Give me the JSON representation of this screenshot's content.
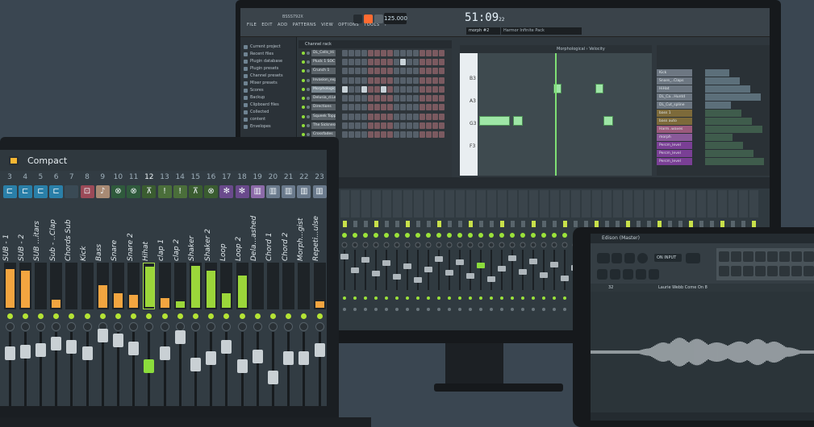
{
  "monitor": {
    "menu": [
      "FILE",
      "EDIT",
      "ADD",
      "PATTERNS",
      "VIEW",
      "OPTIONS",
      "TOOLS",
      "?"
    ],
    "project_id": "BSSS792X",
    "tempo": "125.000",
    "clock": {
      "main": "51:09",
      "sub": "22"
    },
    "pattern": "morph #2",
    "news": "Harmor Infinite Pack",
    "browser_items": [
      "Current project",
      "Recent files",
      "Plugin database",
      "Plugin presets",
      "Channel presets",
      "Mixer presets",
      "Scores",
      "Backup",
      "Clipboard files",
      "Collected",
      "content",
      "Envelopes"
    ],
    "rack_title": "Channel rack",
    "rack_channels": [
      "DL_Cells_Hi",
      "Pluck 1 SOC",
      "Crunch 1",
      "Invasion_expl",
      "Morphological",
      "Delusia_d.Lead",
      "Directions",
      "Squeek Topper",
      "The Sickness",
      "Crossfades"
    ],
    "pianoroll_header": "Morphological › Velocity",
    "key_labels": [
      "B3",
      "A3",
      "G3",
      "F3"
    ],
    "playlist_tracks": [
      "Kick",
      "Snare_..Claps",
      "HiHat",
      "DL_Ca...Huntd",
      "DL_Cut_spline",
      "bass 1",
      "bass auto",
      "Harm..waves",
      "morph",
      "Percm_level",
      "Percm_level",
      "Percm_level"
    ]
  },
  "laptop": {
    "title": "Compact",
    "channel_numbers": [
      "3",
      "4",
      "5",
      "6",
      "7",
      "8",
      "9",
      "10",
      "11",
      "12",
      "13",
      "14",
      "15",
      "16",
      "17",
      "18",
      "19",
      "20",
      "21",
      "22",
      "23"
    ],
    "channel_names": [
      "SUB - 1",
      "SUB - 2",
      "SUB ...itars",
      "Sub - ..Clap",
      "Chords Sub",
      "Kick",
      "Bass",
      "Snare",
      "Snare 2",
      "Hihat",
      "clap 1",
      "clap 2",
      "Shaker",
      "Shaker 2",
      "Loop",
      "Loop 2",
      "Dela...ashed",
      "Chord 1",
      "Chord 2",
      "Morph...gist",
      "Repeti...ulse"
    ],
    "selected_index": 9
  },
  "tablet": {
    "title": "Edison (Master)",
    "on_input": "ON INPUT",
    "sample_number": "32",
    "sample_title": "Laurie Webb Come On 8"
  },
  "colors": {
    "accent_orange": "#ff6b31",
    "green": "#8bdc3c",
    "meter_orange": "#f2a540"
  }
}
